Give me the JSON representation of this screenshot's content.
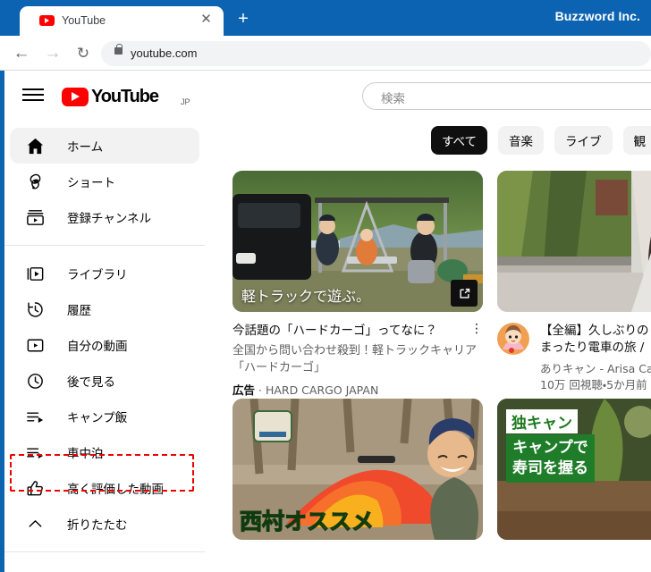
{
  "window": {
    "title": "Buzzword Inc."
  },
  "browser": {
    "tab": {
      "label": "YouTube",
      "favicon": "youtube-favicon",
      "close": "✕"
    },
    "new_tab": "+",
    "nav": {
      "back": "←",
      "forward": "→",
      "reload": "↻"
    },
    "omnibox": {
      "url": "youtube.com",
      "lock": "lock-icon"
    }
  },
  "yt_header": {
    "menu": "hamburger-menu",
    "logo_text": "YouTube",
    "country_code": "JP",
    "search": {
      "placeholder": "検索",
      "value": ""
    }
  },
  "sidebar": {
    "group1": [
      {
        "label": "ホーム",
        "icon": "home-icon",
        "active": true
      },
      {
        "label": "ショート",
        "icon": "shorts-icon",
        "active": false
      },
      {
        "label": "登録チャンネル",
        "icon": "subscriptions-icon",
        "active": false
      }
    ],
    "group2": [
      {
        "label": "ライブラリ",
        "icon": "library-icon",
        "active": false
      },
      {
        "label": "履歴",
        "icon": "history-icon",
        "active": false
      },
      {
        "label": "自分の動画",
        "icon": "your-videos-icon",
        "active": false
      },
      {
        "label": "後で見る",
        "icon": "watch-later-icon",
        "active": false
      },
      {
        "label": "キャンプ飯",
        "icon": "playlist-icon",
        "active": false,
        "highlighted": true
      },
      {
        "label": "車中泊",
        "icon": "playlist-icon",
        "active": false
      },
      {
        "label": "高く評価した動画",
        "icon": "thumbs-up-icon",
        "active": false
      },
      {
        "label": "折りたたむ",
        "icon": "chevron-up-icon",
        "active": false
      }
    ],
    "highlight_color": "#ee0000"
  },
  "chips": [
    {
      "label": "すべて",
      "selected": true
    },
    {
      "label": "音楽",
      "selected": false
    },
    {
      "label": "ライブ",
      "selected": false
    },
    {
      "label": "観",
      "selected": false
    }
  ],
  "videos": [
    {
      "thumb_caption": "軽トラックで遊ぶ。",
      "badge": "external-link-icon",
      "title": "今話題の「ハードカーゴ」ってなに？",
      "menu": "⋮",
      "description": "全国から問い合わせ殺到！軽トラックキャリア「ハードカーゴ」",
      "ad_label": "広告",
      "advertiser": "HARD CARGO JAPAN"
    },
    {
      "title_line1": "【全編】久しぶりの",
      "title_line2": "まったり電車の旅 /",
      "channel": "ありキャン - Arisa Cam",
      "stats": "10万 回視聴・5か月前",
      "avatar": "channel-avatar"
    },
    {
      "thumb_caption": "西村オススメ"
    },
    {
      "thumb_caption_top": "独キャン",
      "thumb_caption_body": "キャンプで\n寿司を握る"
    }
  ],
  "colors": {
    "brand_red": "#ff0000",
    "chrome_blue": "#0c63b1",
    "chip_selected_bg": "#0f0f0f",
    "highlight": "#ee0000"
  }
}
